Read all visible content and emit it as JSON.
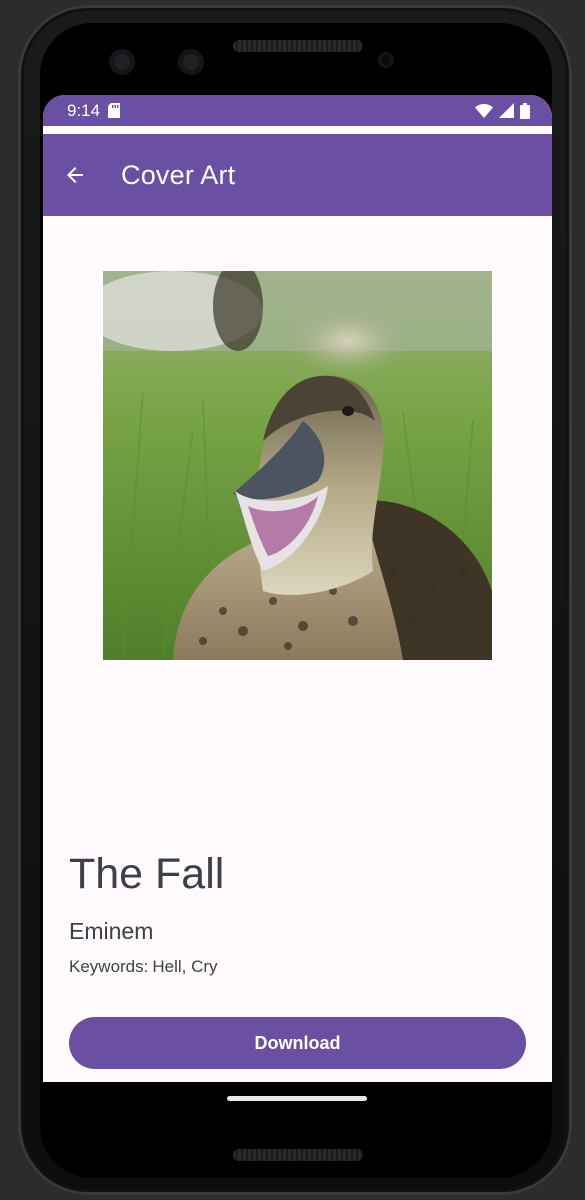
{
  "status_bar": {
    "time": "9:14",
    "icons": [
      "sd-card-icon",
      "wifi-icon",
      "signal-icon",
      "battery-icon"
    ]
  },
  "app_bar": {
    "title": "Cover Art",
    "back_icon": "arrow-back-icon"
  },
  "cover_art": {
    "description_icon": "duck-photo"
  },
  "song": {
    "title": "The Fall",
    "artist": "Eminem",
    "keywords_label": "Keywords:",
    "keywords_value": "Hell, Cry"
  },
  "actions": {
    "download_label": "Download"
  },
  "colors": {
    "primary": "#6a4fa3",
    "background": "#fffbfe",
    "text": "#3f3f46"
  }
}
